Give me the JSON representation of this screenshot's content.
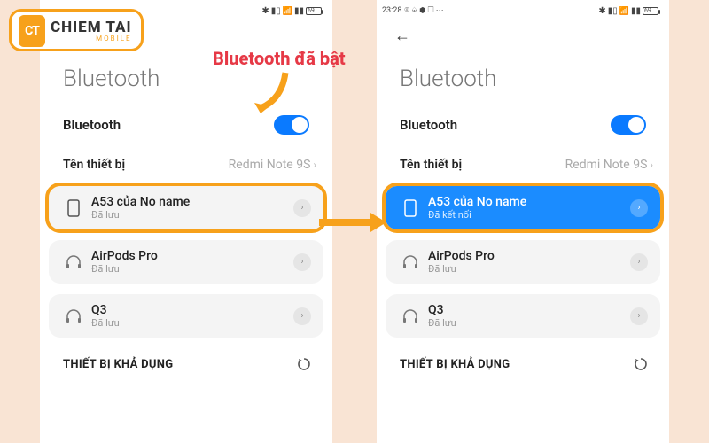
{
  "logo": {
    "icon_text": "CT",
    "main": "CHIEM TAI",
    "sub": "MOBILE"
  },
  "annotation": {
    "label": "Bluetooth đã bật"
  },
  "left": {
    "status": {
      "bt_icon": "✱",
      "batt": "69"
    },
    "page_title": "Bluetooth",
    "bluetooth_label": "Bluetooth",
    "device_name_label": "Tên thiết bị",
    "device_name_value": "Redmi Note 9S",
    "devices": [
      {
        "name": "A53 của No name",
        "sub": "Đã lưu",
        "icon": "phone"
      },
      {
        "name": "AirPods Pro",
        "sub": "Đã lưu",
        "icon": "headphones"
      },
      {
        "name": "Q3",
        "sub": "Đã lưu",
        "icon": "headphones"
      }
    ],
    "available_label": "THIẾT BỊ KHẢ DỤNG"
  },
  "right": {
    "status": {
      "time": "23:28",
      "notif": "⌾ ♤ ⬢ ☐ ⋯",
      "batt": "69"
    },
    "page_title": "Bluetooth",
    "bluetooth_label": "Bluetooth",
    "device_name_label": "Tên thiết bị",
    "device_name_value": "Redmi Note 9S",
    "devices": [
      {
        "name": "A53 của No name",
        "sub": "Đã kết nối",
        "icon": "phone"
      },
      {
        "name": "AirPods Pro",
        "sub": "Đã lưu",
        "icon": "headphones"
      },
      {
        "name": "Q3",
        "sub": "Đã lưu",
        "icon": "headphones"
      }
    ],
    "available_label": "THIẾT BỊ KHẢ DỤNG"
  }
}
